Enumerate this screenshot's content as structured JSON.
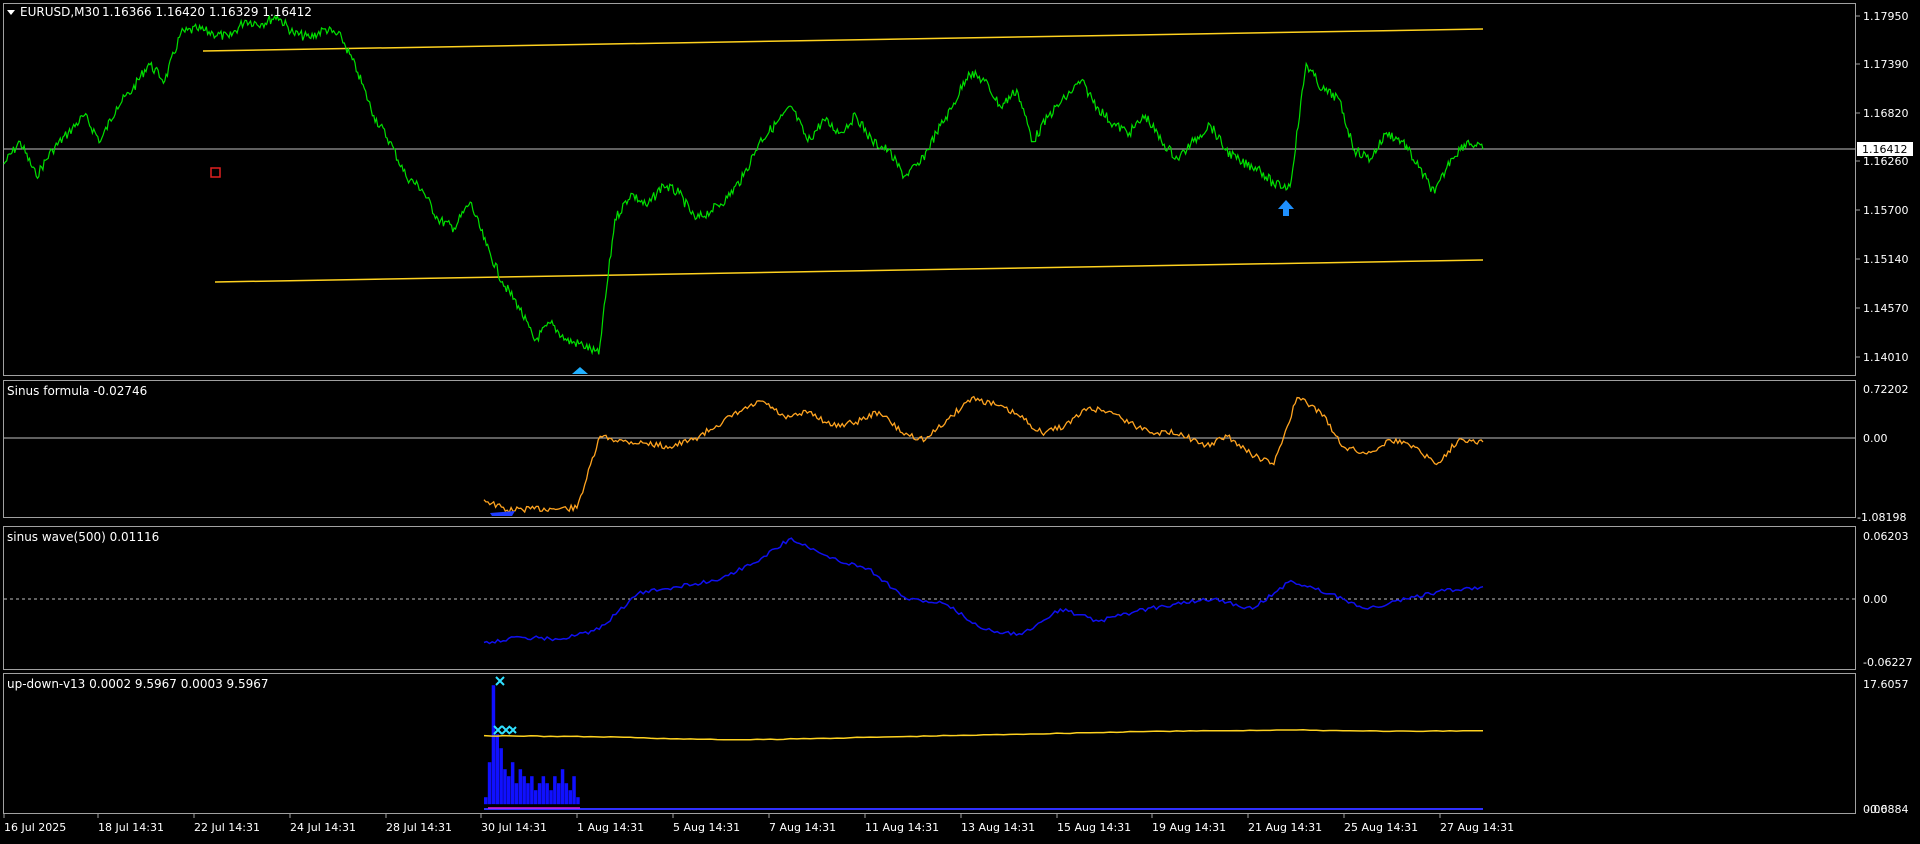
{
  "main": {
    "title": "EURUSD,M30",
    "ohlc": "1.16366 1.16420 1.16329 1.16412",
    "price_axis": [
      "1.17950",
      "1.17390",
      "1.16820",
      "1.16260",
      "1.15700",
      "1.15140",
      "1.14570",
      "1.14010"
    ],
    "current_price": "1.16412",
    "colors": {
      "price": "#00e000",
      "channel": "#ffd21f",
      "marker_up": "#1e90ff",
      "marker_box": "#e02020"
    }
  },
  "sinus_formula": {
    "label": "Sinus formula -0.02746",
    "axis": [
      "0.72202",
      "0.00",
      "-1.08198"
    ],
    "color": "#ffa420"
  },
  "sinus_wave": {
    "label": "sinus wave(500) 0.01116",
    "axis": [
      "0.06203",
      "0.00",
      "-0.06227"
    ],
    "color": "#1010f0"
  },
  "up_down": {
    "label": "up-down-v13 0.0002 9.5967 0.0003 9.5967",
    "axis": [
      "17.6057",
      "0.00",
      "-0.6884"
    ],
    "colors": {
      "hist": "#1010ff",
      "line": "#ffd21f",
      "cross": "#30e0ff"
    }
  },
  "time_axis": [
    "16 Jul 2025",
    "18 Jul 14:31",
    "22 Jul 14:31",
    "24 Jul 14:31",
    "28 Jul 14:31",
    "30 Jul 14:31",
    "1 Aug 14:31",
    "5 Aug 14:31",
    "7 Aug 14:31",
    "11 Aug 14:31",
    "13 Aug 14:31",
    "15 Aug 14:31",
    "19 Aug 14:31",
    "21 Aug 14:31",
    "25 Aug 14:31",
    "27 Aug 14:31"
  ],
  "chart_data": [
    {
      "type": "line",
      "title": "EURUSD,M30",
      "series": [
        {
          "name": "EURUSD,M30",
          "values": [
            1.1624,
            1.165,
            1.161,
            1.164,
            1.166,
            1.168,
            1.165,
            1.169,
            1.171,
            1.174,
            1.172,
            1.1775,
            1.178,
            1.1775,
            1.177,
            1.179,
            1.1786,
            1.1795,
            1.1775,
            1.177,
            1.178,
            1.177,
            1.173,
            1.168,
            1.165,
            1.161,
            1.1595,
            1.156,
            1.155,
            1.158,
            1.153,
            1.1488,
            1.146,
            1.142,
            1.144,
            1.142,
            1.1415,
            1.1404,
            1.156,
            1.159,
            1.1575,
            1.16,
            1.159,
            1.156,
            1.157,
            1.1585,
            1.161,
            1.165,
            1.167,
            1.169,
            1.165,
            1.1675,
            1.166,
            1.168,
            1.165,
            1.164,
            1.161,
            1.1625,
            1.166,
            1.169,
            1.173,
            1.172,
            1.169,
            1.171,
            1.165,
            1.168,
            1.17,
            1.172,
            1.169,
            1.167,
            1.166,
            1.168,
            1.165,
            1.163,
            1.165,
            1.167,
            1.164,
            1.1625,
            1.162,
            1.16,
            1.1598,
            1.174,
            1.171,
            1.17,
            1.164,
            1.163,
            1.166,
            1.165,
            1.162,
            1.159,
            1.163,
            1.165,
            1.1641
          ]
        }
      ],
      "annotations": [
        "channel upper line",
        "channel lower line",
        "horizontal line at 1.16412"
      ]
    },
    {
      "type": "line",
      "title": "Sinus formula -0.02746",
      "ylim": [
        -1.08198,
        0.72202
      ],
      "series": [
        {
          "name": "Sinus formula",
          "values": [
            -0.85,
            -1.0,
            -0.98,
            -0.98,
            -0.97,
            0.05,
            -0.02,
            -0.05,
            -0.1,
            0.0,
            0.2,
            0.4,
            0.55,
            0.3,
            0.4,
            0.2,
            0.25,
            0.4,
            0.1,
            0.0,
            0.3,
            0.6,
            0.5,
            0.35,
            0.1,
            0.2,
            0.45,
            0.4,
            0.2,
            0.1,
            0.1,
            -0.1,
            0.05,
            -0.2,
            -0.35,
            0.6,
            0.4,
            -0.1,
            -0.2,
            0.0,
            -0.08,
            -0.35,
            0.02,
            -0.03
          ]
        }
      ]
    },
    {
      "type": "line",
      "title": "sinus wave(500) 0.01116",
      "ylim": [
        -0.06227,
        0.06203
      ],
      "series": [
        {
          "name": "sinus wave(500)",
          "values": [
            -0.043,
            -0.038,
            -0.04,
            -0.03,
            0.005,
            0.012,
            0.018,
            0.035,
            0.06,
            0.04,
            0.03,
            0.0,
            -0.005,
            -0.03,
            -0.035,
            -0.01,
            -0.022,
            -0.012,
            -0.005,
            0.0,
            -0.01,
            0.018,
            0.005,
            -0.01,
            0.0,
            0.008,
            0.012
          ]
        }
      ]
    },
    {
      "type": "bar",
      "title": "up-down-v13 0.0002 9.5967 0.0003 9.5967",
      "ylim": [
        -0.6884,
        17.6057
      ],
      "series": [
        {
          "name": "histogram",
          "values": [
            1,
            6,
            17,
            10,
            8,
            5,
            4,
            6,
            3,
            5,
            4,
            3,
            4,
            2,
            3,
            4,
            3,
            2,
            4,
            3,
            5,
            3,
            2,
            4,
            1
          ]
        },
        {
          "name": "line",
          "values": [
            9.8,
            9.7,
            9.6,
            9.3,
            9.2,
            9.4,
            9.6,
            9.8,
            10.0,
            10.2,
            10.4,
            10.5,
            10.6,
            10.5,
            10.4,
            10.5
          ]
        }
      ]
    }
  ]
}
